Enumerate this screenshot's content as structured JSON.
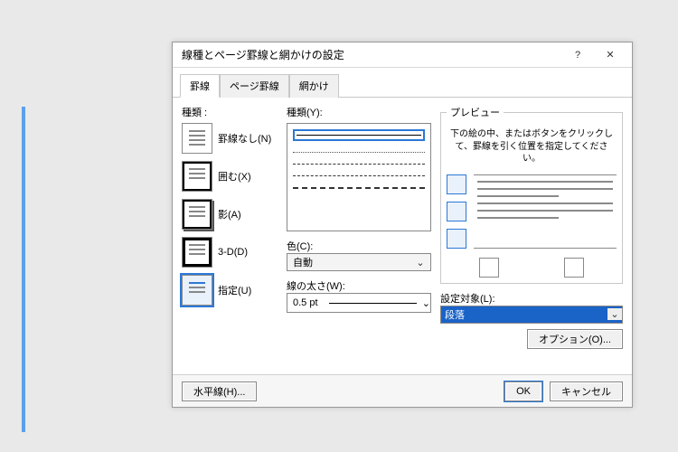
{
  "dialog": {
    "title": "線種とページ罫線と網かけの設定",
    "help": "?",
    "close": "✕"
  },
  "tabs": {
    "t1": "罫線",
    "t2": "ページ罫線",
    "t3": "網かけ"
  },
  "settings": {
    "group_label": "種類 :",
    "none": "罫線なし(N)",
    "box": "囲む(X)",
    "shadow": "影(A)",
    "threeD": "3-D(D)",
    "custom": "指定(U)"
  },
  "style": {
    "label": "種類(Y):",
    "color_label": "色(C):",
    "color_value": "自動",
    "width_label": "線の太さ(W):",
    "width_value": "0.5 pt"
  },
  "preview": {
    "legend": "プレビュー",
    "hint": "下の絵の中、またはボタンをクリックして、罫線を引く位置を指定してください。",
    "apply_label": "設定対象(L):",
    "apply_value": "段落",
    "options_btn": "オプション(O)..."
  },
  "footer": {
    "hr_btn": "水平線(H)...",
    "ok": "OK",
    "cancel": "キャンセル"
  }
}
